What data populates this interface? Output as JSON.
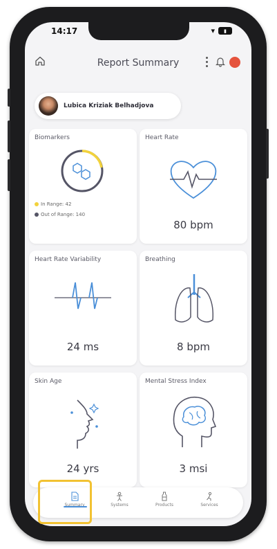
{
  "status": {
    "time": "14:17"
  },
  "header": {
    "title": "Report Summary",
    "notification_count": ""
  },
  "user": {
    "name": "Lubica Kriziak Belhadjova"
  },
  "cards": {
    "biomarkers": {
      "title": "Biomarkers",
      "in_range": "In Range: 42",
      "out_of_range": "Out of Range: 140"
    },
    "heart_rate": {
      "title": "Heart Rate",
      "value": "80 bpm"
    },
    "hrv": {
      "title": "Heart Rate Variability",
      "value": "24 ms"
    },
    "breathing": {
      "title": "Breathing",
      "value": "8 bpm"
    },
    "skin_age": {
      "title": "Skin Age",
      "value": "24 yrs"
    },
    "mental_stress": {
      "title": "Mental Stress Index",
      "value": "3 msi"
    }
  },
  "nav": {
    "items": [
      {
        "label": "Summary",
        "icon": "document-icon"
      },
      {
        "label": "Systems",
        "icon": "body-icon"
      },
      {
        "label": "Products",
        "icon": "bottle-icon"
      },
      {
        "label": "Services",
        "icon": "service-icon"
      }
    ]
  },
  "colors": {
    "accent": "#4a8fd8",
    "in_range": "#f2d23c",
    "out_of_range": "#555566",
    "badge": "#e5533d",
    "highlight": "#f2c232"
  }
}
